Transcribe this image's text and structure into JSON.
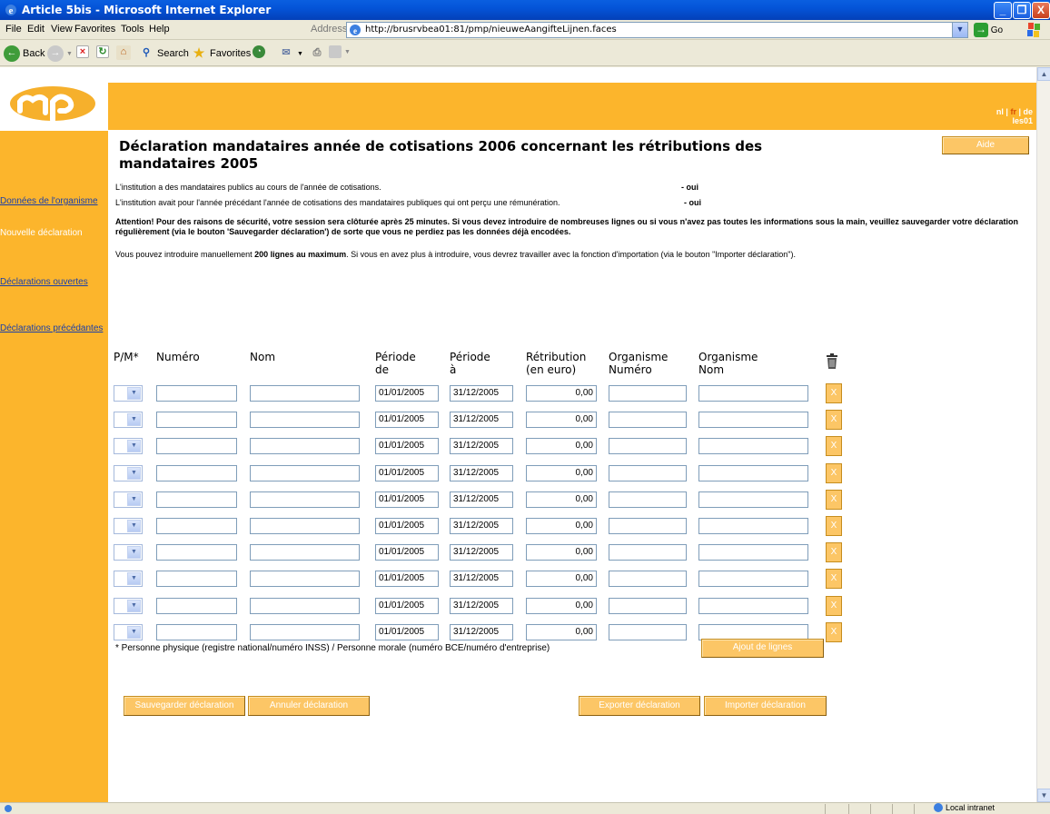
{
  "window": {
    "title": "Article 5bis - Microsoft Internet Explorer",
    "controls": {
      "minimize": "_",
      "maximize": "❐",
      "close": "X"
    }
  },
  "menubar": [
    "File",
    "Edit",
    "View",
    "Favorites",
    "Tools",
    "Help"
  ],
  "address": {
    "label": "Address",
    "url": "http://brusrvbea01:81/pmp/nieuweAangifteLijnen.faces",
    "go": "Go"
  },
  "toolbar": {
    "back": "Back",
    "search": "Search",
    "favorites": "Favorites"
  },
  "lang": {
    "nl": "nl",
    "sep1": " | ",
    "fr": "fr",
    "sep2": " | ",
    "de": "de",
    "user": "les01"
  },
  "sidebar": {
    "items": [
      {
        "label": "Données de l'organisme"
      },
      {
        "label": "Nouvelle déclaration"
      },
      {
        "label": "Déclarations ouvertes"
      },
      {
        "label": "Déclarations précédantes"
      }
    ]
  },
  "main": {
    "title": "Déclaration mandataires année de cotisations 2006 concernant les rétributions des mandataires 2005",
    "help_button": "Aide",
    "info1": "L'institution a des mandataires publics au cours de l'année de cotisations.",
    "info1_value": "- oui",
    "info2": "L'institution avait pour l'année précédant l'année de cotisations des mandataires publiques qui ont perçu une rémunération.",
    "info2_value": "- oui",
    "warning_strong": "Attention! Pour des raisons de sécurité, votre session sera clôturée après 25 minutes. Si vous devez introduire de nombreuses lignes ou si vous n'avez pas toutes les informations sous la main, veuillez sauvegarder votre déclaration régulièrement (via le bouton 'Sauvegarder déclaration') de sorte que vous ne perdiez pas les données déjà encodées.",
    "manual_prefix": "Vous pouvez introduire manuellement ",
    "manual_bold": "200 lignes au maximum",
    "manual_suffix": ". Si vous en avez plus à introduire, vous devrez travailler avec la fonction d'importation (via le bouton \"Importer déclaration\").",
    "columns": {
      "pm": "P/M*",
      "numero": "Numéro",
      "nom": "Nom",
      "periode_de_1": "Période",
      "periode_de_2": "de",
      "periode_a_1": "Période",
      "periode_a_2": "à",
      "retrib_1": "Rétribution",
      "retrib_2": "(en euro)",
      "org_num_1": "Organisme",
      "org_num_2": "Numéro",
      "org_nom_1": "Organisme",
      "org_nom_2": "Nom"
    },
    "rows": [
      {
        "de": "01/01/2005",
        "a": "31/12/2005",
        "retribution": "0,00",
        "delete": "X"
      },
      {
        "de": "01/01/2005",
        "a": "31/12/2005",
        "retribution": "0,00",
        "delete": "X"
      },
      {
        "de": "01/01/2005",
        "a": "31/12/2005",
        "retribution": "0,00",
        "delete": "X"
      },
      {
        "de": "01/01/2005",
        "a": "31/12/2005",
        "retribution": "0,00",
        "delete": "X"
      },
      {
        "de": "01/01/2005",
        "a": "31/12/2005",
        "retribution": "0,00",
        "delete": "X"
      },
      {
        "de": "01/01/2005",
        "a": "31/12/2005",
        "retribution": "0,00",
        "delete": "X"
      },
      {
        "de": "01/01/2005",
        "a": "31/12/2005",
        "retribution": "0,00",
        "delete": "X"
      },
      {
        "de": "01/01/2005",
        "a": "31/12/2005",
        "retribution": "0,00",
        "delete": "X"
      },
      {
        "de": "01/01/2005",
        "a": "31/12/2005",
        "retribution": "0,00",
        "delete": "X"
      },
      {
        "de": "01/01/2005",
        "a": "31/12/2005",
        "retribution": "0,00",
        "delete": "X"
      }
    ],
    "footnote": "* Personne physique (registre national/numéro INSS) / Personne morale (numéro BCE/numéro d'entreprise)",
    "add_lines": "Ajout de lignes",
    "save": "Sauvegarder déclaration",
    "cancel": "Annuler déclaration",
    "export": "Exporter déclaration",
    "import": "Importer déclaration"
  },
  "status": {
    "zone": "Local intranet"
  },
  "colors": {
    "accent": "#fcb52c",
    "button": "#fcc666",
    "link": "#1a3fa8",
    "titlebar": "#0454d8"
  }
}
